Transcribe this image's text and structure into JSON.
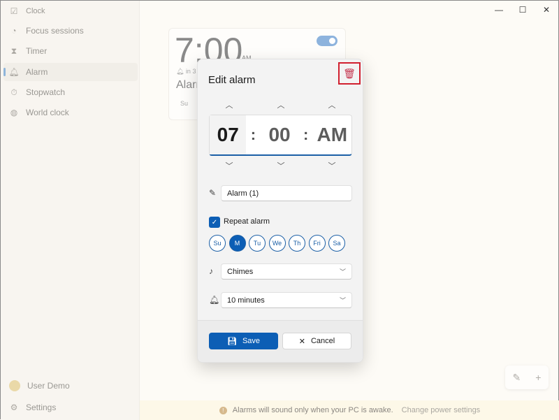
{
  "app": {
    "title": "Clock"
  },
  "sidebar": {
    "items": [
      {
        "label": "Focus sessions",
        "icon": "focus-icon"
      },
      {
        "label": "Timer",
        "icon": "hourglass-icon"
      },
      {
        "label": "Alarm",
        "icon": "bell-icon",
        "active": true
      },
      {
        "label": "Stopwatch",
        "icon": "stopwatch-icon"
      },
      {
        "label": "World clock",
        "icon": "globe-icon"
      }
    ],
    "user": "User Demo",
    "settings": "Settings"
  },
  "alarm_card": {
    "time": "7:00",
    "ampm": "AM",
    "remaining": "in 3",
    "name": "Alarr",
    "day": "Su",
    "enabled": true
  },
  "dialog": {
    "title": "Edit alarm",
    "hour": "07",
    "minute": "00",
    "period": "AM",
    "name_value": "Alarm (1)",
    "repeat_label": "Repeat alarm",
    "repeat_checked": true,
    "days": [
      {
        "label": "Su",
        "on": false
      },
      {
        "label": "M",
        "on": true
      },
      {
        "label": "Tu",
        "on": false
      },
      {
        "label": "We",
        "on": false
      },
      {
        "label": "Th",
        "on": false
      },
      {
        "label": "Fri",
        "on": false
      },
      {
        "label": "Sa",
        "on": false
      }
    ],
    "sound": "Chimes",
    "snooze": "10 minutes",
    "save": "Save",
    "cancel": "Cancel"
  },
  "info": {
    "message": "Alarms will sound only when your PC is awake.",
    "link": "Change power settings"
  },
  "colors": {
    "accent": "#0c5eb5",
    "highlight": "#d1202f"
  }
}
